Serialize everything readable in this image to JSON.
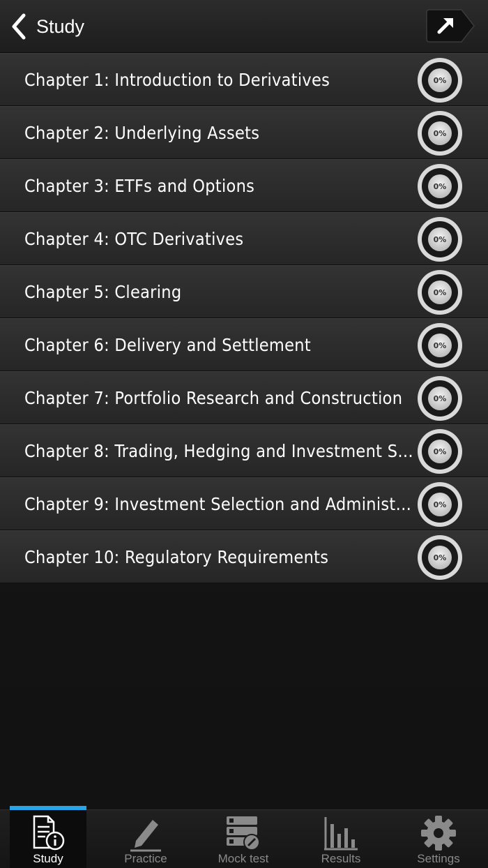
{
  "header": {
    "back_label": "Study"
  },
  "chapters": [
    {
      "title": "Chapter 1: Introduction to Derivatives",
      "progress": "0%"
    },
    {
      "title": "Chapter 2: Underlying Assets",
      "progress": "0%"
    },
    {
      "title": "Chapter 3: ETFs and Options",
      "progress": "0%"
    },
    {
      "title": "Chapter 4:  OTC Derivatives",
      "progress": "0%"
    },
    {
      "title": "Chapter 5: Clearing",
      "progress": "0%"
    },
    {
      "title": "Chapter 6: Delivery and Settlement",
      "progress": "0%"
    },
    {
      "title": "Chapter 7: Portfolio Research and Construction",
      "progress": "0%"
    },
    {
      "title": "Chapter 8: Trading, Hedging and Investment Str...",
      "progress": "0%"
    },
    {
      "title": "Chapter 9: Investment Selection and Administr...",
      "progress": "0%"
    },
    {
      "title": "Chapter 10: Regulatory Requirements",
      "progress": "0%"
    }
  ],
  "tabs": [
    {
      "label": "Study",
      "icon": "study-info-icon",
      "active": true
    },
    {
      "label": "Practice",
      "icon": "pencil-icon",
      "active": false
    },
    {
      "label": "Mock test",
      "icon": "mock-test-icon",
      "active": false
    },
    {
      "label": "Results",
      "icon": "bar-chart-icon",
      "active": false
    },
    {
      "label": "Settings",
      "icon": "gear-icon",
      "active": false
    }
  ],
  "colors": {
    "accent": "#27a3e8",
    "text": "#ffffff",
    "inactive_tab": "#8a8a8a"
  }
}
